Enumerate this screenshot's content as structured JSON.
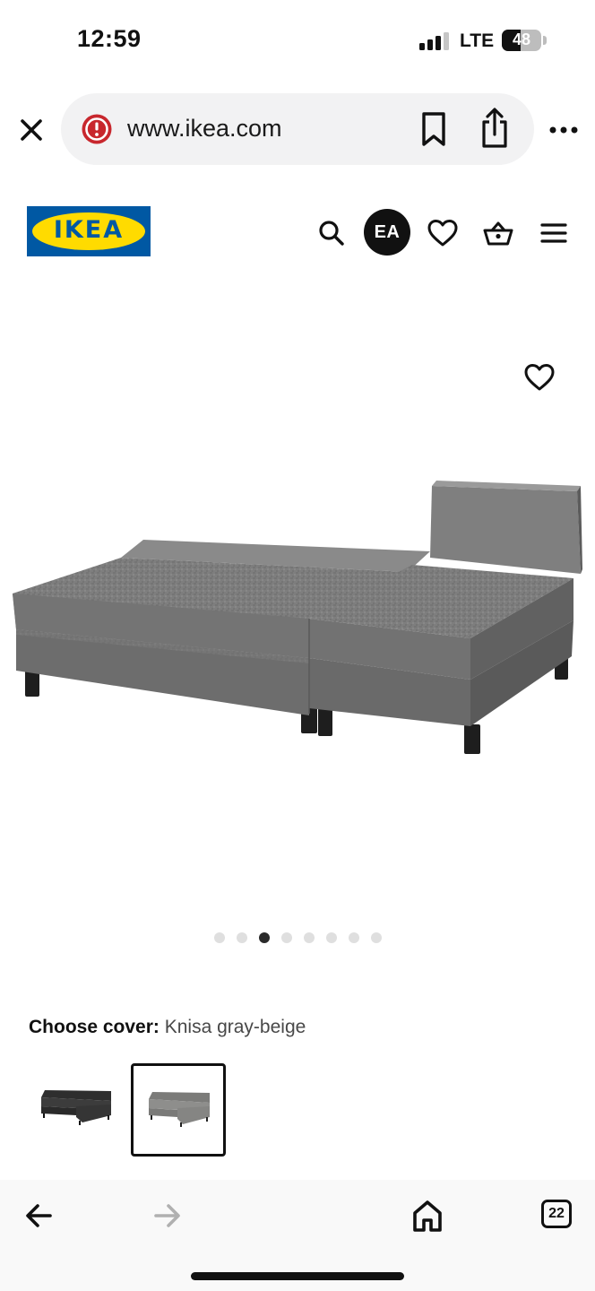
{
  "status_bar": {
    "time": "12:59",
    "network": "LTE",
    "battery_percent": "48",
    "battery_level": 0.48,
    "signal_bars": 3,
    "icons": [
      "signal-icon",
      "battery-icon"
    ]
  },
  "browser": {
    "url": "www.ikea.com",
    "icons": [
      "close-icon",
      "site-alert-icon",
      "bookmark-icon",
      "share-icon",
      "more-icon"
    ]
  },
  "header": {
    "logo_text": "IKEA",
    "account_initials": "EA",
    "icons": [
      "search-icon",
      "heart-icon",
      "basket-icon",
      "menu-icon"
    ],
    "brand_colors": {
      "blue": "#0058a3",
      "yellow": "#ffdb00"
    }
  },
  "product": {
    "fabric_color": "#7e7e7e",
    "carousel": {
      "total": 8,
      "active_index": 2
    }
  },
  "cover": {
    "label": "Choose cover:",
    "value": "Knisa gray-beige",
    "options": [
      {
        "name": "dark-gray",
        "color": "#3c3c3c",
        "selected": false
      },
      {
        "name": "gray-beige",
        "color": "#8b8b89",
        "selected": true
      }
    ]
  },
  "bottom_nav": {
    "tab_count": "22",
    "icons": [
      "back-arrow-icon",
      "forward-arrow-icon",
      "home-icon",
      "tabs-icon"
    ]
  }
}
